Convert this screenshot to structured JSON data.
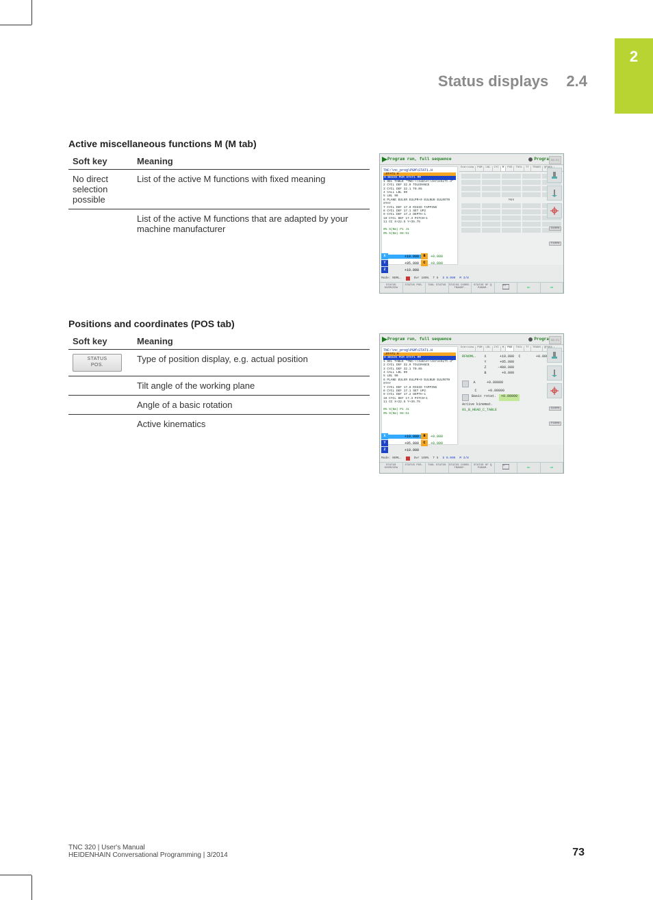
{
  "chapter_tab": "2",
  "header": {
    "title": "Status displays",
    "section": "2.4"
  },
  "section_m": {
    "title": "Active miscellaneous functions M (M tab)",
    "table": {
      "headers": [
        "Soft key",
        "Meaning"
      ],
      "rows": [
        {
          "softkey": "No direct selection possible",
          "meaning": "List of the active M functions with fixed meaning"
        },
        {
          "softkey": "",
          "meaning": "List of the active M functions that are adapted by your machine manufacturer"
        }
      ]
    }
  },
  "section_pos": {
    "title": "Positions and coordinates (POS tab)",
    "table": {
      "headers": [
        "Soft key",
        "Meaning"
      ],
      "softkey_button": {
        "line1": "STATUS",
        "line2": "POS."
      },
      "rows": [
        {
          "meaning": "Type of position display, e.g. actual position"
        },
        {
          "meaning": "Tilt angle of the working plane"
        },
        {
          "meaning": "Angle of a basic rotation"
        },
        {
          "meaning": "Active kinematics"
        }
      ]
    }
  },
  "screenshot_common": {
    "mode_left": "Program run, full sequence",
    "mode_left_sub": "Program run full sequence",
    "mode_right": "Programming",
    "clock": "08:51",
    "path": "TNC:\\nc_prog\\PGM\\STAT1.H",
    "hl_orange": "→STAT1.H",
    "hl_blue": "0  BEGIN PGM STAT1 MM",
    "code_lines": [
      "1  SEL TABLE \"TNC:\\\\table\\\\zeroshift.d\"",
      "2  CYCL DEF 32.0 TOLERANCE",
      "3  CYCL DEF 32.1 T0.05",
      "4  CALL LBL 99",
      "5  LBL 99",
      "6  PLANE EULER EULPR+0 EULNU0 EULROT0 STAY",
      "7  CYCL DEF 17.0 RIGID TAPPING",
      "8  CYCL DEF 17.1 SET UP2",
      "9  CYCL DEF 17.2 DEPTH-1",
      "10 CYCL DEF 17.3 PITCH+1",
      "11 CC  X+22.5  Y+35.75"
    ],
    "code_footer1": "0% S(Nm) P1  J1",
    "code_footer2": "0% S(Nm) 08:51",
    "pos": {
      "X": "+10.000",
      "Y": "+95.000",
      "Z": "+10.000",
      "B": "+0.000",
      "C": "+0.000"
    },
    "meta": {
      "mode": "Mode: NOML.",
      "ovr1": "Ovr 100%",
      "ovr2": "Ovr 100%",
      "t": "T 5",
      "s": "S 0.000",
      "m": "M 3/8"
    },
    "softkeys": [
      "STATUS OVERVIEW",
      "STATUS POS.",
      "TOOL STATUS",
      "STATUS COORD. TRANSF.",
      "STATUS OF Q PARAM.",
      "",
      "",
      ""
    ],
    "side_pct1": "S100%",
    "side_pct2": "F100%",
    "side_off": "OFF",
    "side_on": "ON"
  },
  "screenshot_m": {
    "tabs": [
      "Overview",
      "PGM",
      "LBL",
      "CYC",
      "M",
      "POS",
      "TOOL",
      "TT",
      "TRANS",
      "QPARA"
    ],
    "active_tab": "M",
    "center_label": "M89"
  },
  "screenshot_pos": {
    "tabs": [
      "Overview",
      "PGM",
      "LBL",
      "CYC",
      "M",
      "POS",
      "TOOL",
      "TT",
      "TRANS",
      "QPARA"
    ],
    "active_tab": "POS",
    "ref_label": "RFNOML.",
    "rows": [
      {
        "ax": "X",
        "v": "+10.000",
        "c": "C",
        "cv": "+0.000"
      },
      {
        "ax": "Y",
        "v": "+95.000"
      },
      {
        "ax": "Z",
        "v": "-480.000"
      },
      {
        "ax": "B",
        "v": "+0.000"
      }
    ],
    "plane": [
      {
        "ax": "A",
        "v": "+0.00000"
      },
      {
        "ax": "C",
        "v": "+0.00000"
      }
    ],
    "basic_rot_label": "Basic rotat.",
    "basic_rot_val": "+0.00000",
    "kin_label": "Active kinemat.",
    "kin_val": "01_B_HEAD_C_TABLE"
  },
  "footer": {
    "line1": "TNC 320 | User's Manual",
    "line2": "HEIDENHAIN Conversational Programming | 3/2014",
    "page": "73"
  }
}
